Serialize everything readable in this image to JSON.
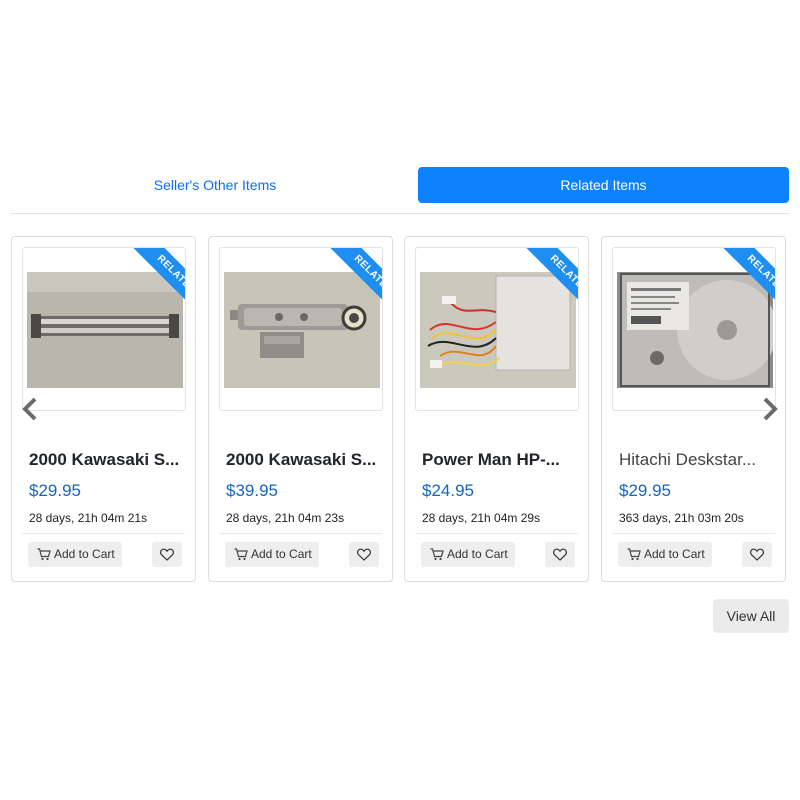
{
  "tabs": {
    "sellers_other": "Seller's Other Items",
    "related": "Related Items"
  },
  "ribbon_label": "RELATED",
  "products": [
    {
      "title": "2000 Kawasaki S...",
      "price": "$29.95",
      "time_left": "28 days, 21h 04m 21s",
      "add_to_cart": "Add to Cart"
    },
    {
      "title": "2000 Kawasaki S...",
      "price": "$39.95",
      "time_left": "28 days, 21h 04m 23s",
      "add_to_cart": "Add to Cart"
    },
    {
      "title": "Power Man HP-...",
      "price": "$24.95",
      "time_left": "28 days, 21h 04m 29s",
      "add_to_cart": "Add to Cart"
    },
    {
      "title": "Hitachi Deskstar...",
      "price": "$29.95",
      "time_left": "363 days, 21h 03m 20s",
      "add_to_cart": "Add to Cart"
    }
  ],
  "view_all": "View All",
  "colors": {
    "accent": "#0d82ff",
    "price": "#1565c0",
    "ribbon": "#1f8ef1"
  },
  "icons": [
    "cart-icon",
    "heart-icon",
    "chevron-left-icon",
    "chevron-right-icon"
  ]
}
